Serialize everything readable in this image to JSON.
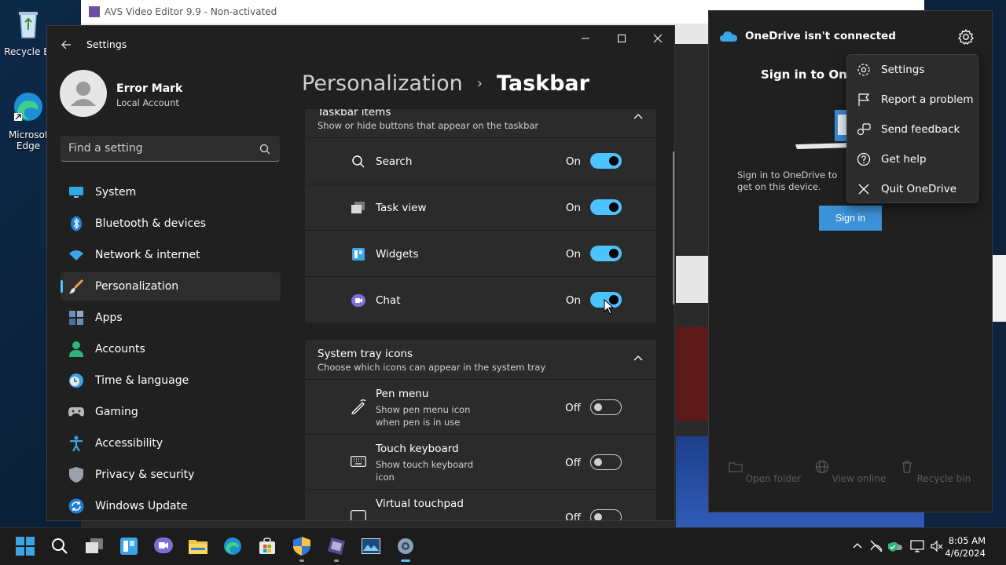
{
  "desktop": {
    "icons": [
      {
        "label": "Recycle Bi",
        "icon": "recycle-bin-icon"
      },
      {
        "label": "Microsof\nEdge",
        "icon": "edge-icon"
      }
    ]
  },
  "background_window": {
    "title": "AVS Video Editor 9.9 - Non-activated"
  },
  "settings": {
    "app_title": "Settings",
    "user": {
      "name": "Error Mark",
      "account": "Local Account"
    },
    "search_placeholder": "Find a setting",
    "nav": [
      {
        "label": "System",
        "icon": "system-icon",
        "active": false
      },
      {
        "label": "Bluetooth & devices",
        "icon": "bluetooth-icon",
        "active": false
      },
      {
        "label": "Network & internet",
        "icon": "wifi-icon",
        "active": false
      },
      {
        "label": "Personalization",
        "icon": "brush-icon",
        "active": true
      },
      {
        "label": "Apps",
        "icon": "apps-icon",
        "active": false
      },
      {
        "label": "Accounts",
        "icon": "accounts-icon",
        "active": false
      },
      {
        "label": "Time & language",
        "icon": "clock-globe-icon",
        "active": false
      },
      {
        "label": "Gaming",
        "icon": "gamepad-icon",
        "active": false
      },
      {
        "label": "Accessibility",
        "icon": "accessibility-icon",
        "active": false
      },
      {
        "label": "Privacy & security",
        "icon": "shield-icon",
        "active": false
      },
      {
        "label": "Windows Update",
        "icon": "update-icon",
        "active": false
      }
    ],
    "breadcrumb": {
      "parent": "Personalization",
      "separator": "›",
      "current": "Taskbar"
    },
    "sections": {
      "taskbar_items": {
        "title": "Taskbar items",
        "subtitle": "Show or hide buttons that appear on the taskbar",
        "rows": [
          {
            "label": "Search",
            "state": "On",
            "on": true,
            "icon": "search-icon"
          },
          {
            "label": "Task view",
            "state": "On",
            "on": true,
            "icon": "task-view-icon"
          },
          {
            "label": "Widgets",
            "state": "On",
            "on": true,
            "icon": "widgets-icon"
          },
          {
            "label": "Chat",
            "state": "On",
            "on": true,
            "icon": "chat-icon"
          }
        ]
      },
      "system_tray": {
        "title": "System tray icons",
        "subtitle": "Choose which icons can appear in the system tray",
        "rows": [
          {
            "label": "Pen menu",
            "sub": "Show pen menu icon when pen is in use",
            "state": "Off",
            "on": false,
            "icon": "pen-icon"
          },
          {
            "label": "Touch keyboard",
            "sub": "Show touch keyboard icon",
            "state": "Off",
            "on": false,
            "icon": "keyboard-icon"
          },
          {
            "label": "Virtual touchpad",
            "sub": "",
            "state": "Off",
            "on": false,
            "icon": "touchpad-icon"
          }
        ]
      }
    }
  },
  "onedrive": {
    "header": "OneDrive isn't connected",
    "signin_title": "Sign in to OneD",
    "signin_text": "Sign in to OneDrive to get on this device.",
    "signin_button": "Sign in",
    "footer": [
      {
        "label": "Open folder",
        "icon": "folder-icon"
      },
      {
        "label": "View online",
        "icon": "globe-icon"
      },
      {
        "label": "Recycle bin",
        "icon": "trash-icon"
      }
    ],
    "menu": [
      {
        "label": "Settings",
        "icon": "gear-icon"
      },
      {
        "label": "Report a problem",
        "icon": "flag-icon"
      },
      {
        "label": "Send feedback",
        "icon": "feedback-icon"
      },
      {
        "label": "Get help",
        "icon": "help-icon"
      },
      {
        "label": "Quit OneDrive",
        "icon": "close-icon"
      }
    ]
  },
  "taskbar": {
    "apps": [
      "start-icon",
      "search-icon",
      "task-view-icon",
      "widgets-icon",
      "chat-icon",
      "file-explorer-icon",
      "edge-icon",
      "store-icon",
      "security-icon",
      "avs-editor-icon",
      "photos-icon",
      "settings-icon"
    ],
    "tray": [
      "chevron-up-icon",
      "network-icon",
      "onedrive-icon",
      "defender-icon",
      "display-icon",
      "speaker-muted-icon"
    ],
    "time": "8:05 AM",
    "date": "4/6/2024"
  },
  "colors": {
    "accent": "#4cc2ff",
    "onedrive_button": "#3c92d8",
    "window_bg": "#202020",
    "card_bg": "#2b2b2b"
  }
}
